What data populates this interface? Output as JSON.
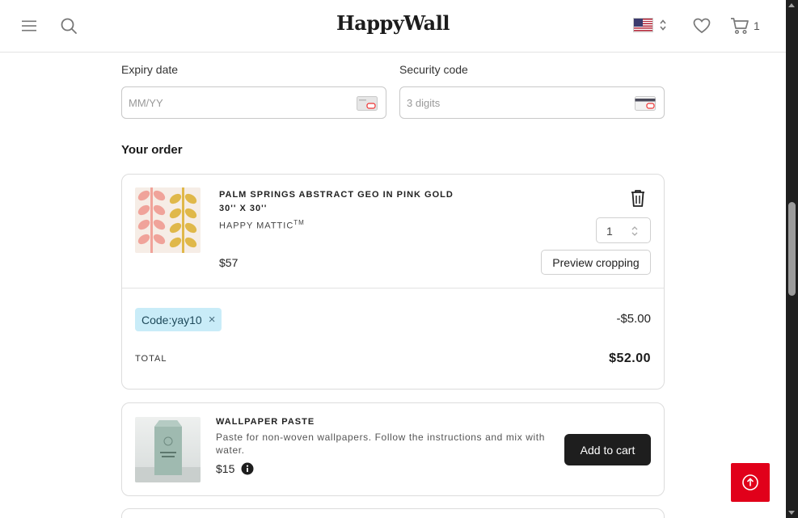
{
  "header": {
    "logo_text": "HappyWall",
    "cart_count": "1"
  },
  "payment": {
    "expiry_label": "Expiry date",
    "expiry_placeholder": "MM/YY",
    "security_label": "Security code",
    "security_placeholder": "3 digits"
  },
  "order": {
    "title": "Your order",
    "item": {
      "name": "PALM SPRINGS ABSTRACT GEO IN PINK GOLD",
      "size": "30'' X 30''",
      "brand": "HAPPY MATTIC",
      "brand_mark": "TM",
      "price": "$57",
      "quantity": "1",
      "preview_label": "Preview cropping"
    },
    "discount": {
      "code_label": "Code:yay10",
      "remove_symbol": "×",
      "amount": "-$5.00"
    },
    "total_label": "TOTAL",
    "total_value": "$52.00"
  },
  "upsell": {
    "name": "WALLPAPER PASTE",
    "description": "Paste for non-woven wallpapers. Follow the instructions and mix with water.",
    "price": "$15",
    "add_label": "Add to cart"
  },
  "colors": {
    "accent_red": "#e1001a",
    "chip_bg": "#c9ecf8",
    "button_dark": "#1e1e1e",
    "pattern_pink": "#f0a39a",
    "pattern_gold": "#e0b84a"
  },
  "icons": [
    "menu-icon",
    "search-icon",
    "us-flag-icon",
    "heart-icon",
    "cart-icon",
    "card-icon",
    "trash-icon",
    "info-icon",
    "arrow-up-icon"
  ]
}
